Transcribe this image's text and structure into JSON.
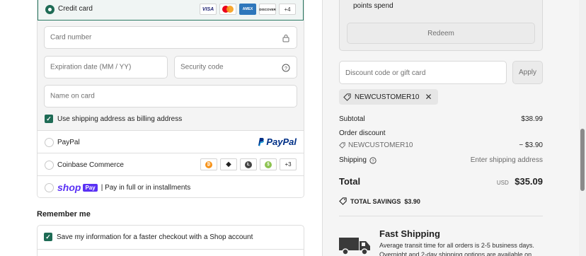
{
  "payment": {
    "credit_card_label": "Credit card",
    "card_brands": [
      "VISA",
      "AMEX",
      "DISCOVER",
      "+4"
    ],
    "card_number_placeholder": "Card number",
    "expiration_placeholder": "Expiration date (MM / YY)",
    "security_code_placeholder": "Security code",
    "name_on_card_placeholder": "Name on card",
    "billing_checkbox_label": "Use shipping address as billing address",
    "paypal_label": "PayPal",
    "paypal_logo_text": "PayPal",
    "coinbase_label": "Coinbase Commerce",
    "coinbase_more": "+3",
    "shop_word": "shop",
    "shop_pay_badge": "Pay",
    "shop_pay_text": "| Pay in full or in installments"
  },
  "remember_me": {
    "title": "Remember me",
    "save_info_label": "Save my information for a faster checkout with a Shop account"
  },
  "rewards": {
    "points_text": "points spend",
    "redeem_label": "Redeem"
  },
  "discount": {
    "placeholder": "Discount code or gift card",
    "apply_label": "Apply",
    "applied_code": "NEWCUSTOMER10"
  },
  "summary": {
    "subtotal_label": "Subtotal",
    "subtotal_value": "$38.99",
    "order_discount_label": "Order discount",
    "discount_code": "NEWCUSTOMER10",
    "discount_value": "− $3.90",
    "shipping_label": "Shipping",
    "shipping_value": "Enter shipping address",
    "total_label": "Total",
    "currency": "USD",
    "total_value": "$35.09",
    "savings_label": "TOTAL SAVINGS",
    "savings_value": "$3.90"
  },
  "shipping_info": {
    "title": "Fast Shipping",
    "line1": "Average transit time for all orders is 2-5 business days.",
    "line2": "Overnight and 2-day shipping options are available on"
  },
  "colors": {
    "accent": "#1e6b55",
    "shop_purple": "#5a31f4",
    "paypal_blue": "#003087"
  }
}
